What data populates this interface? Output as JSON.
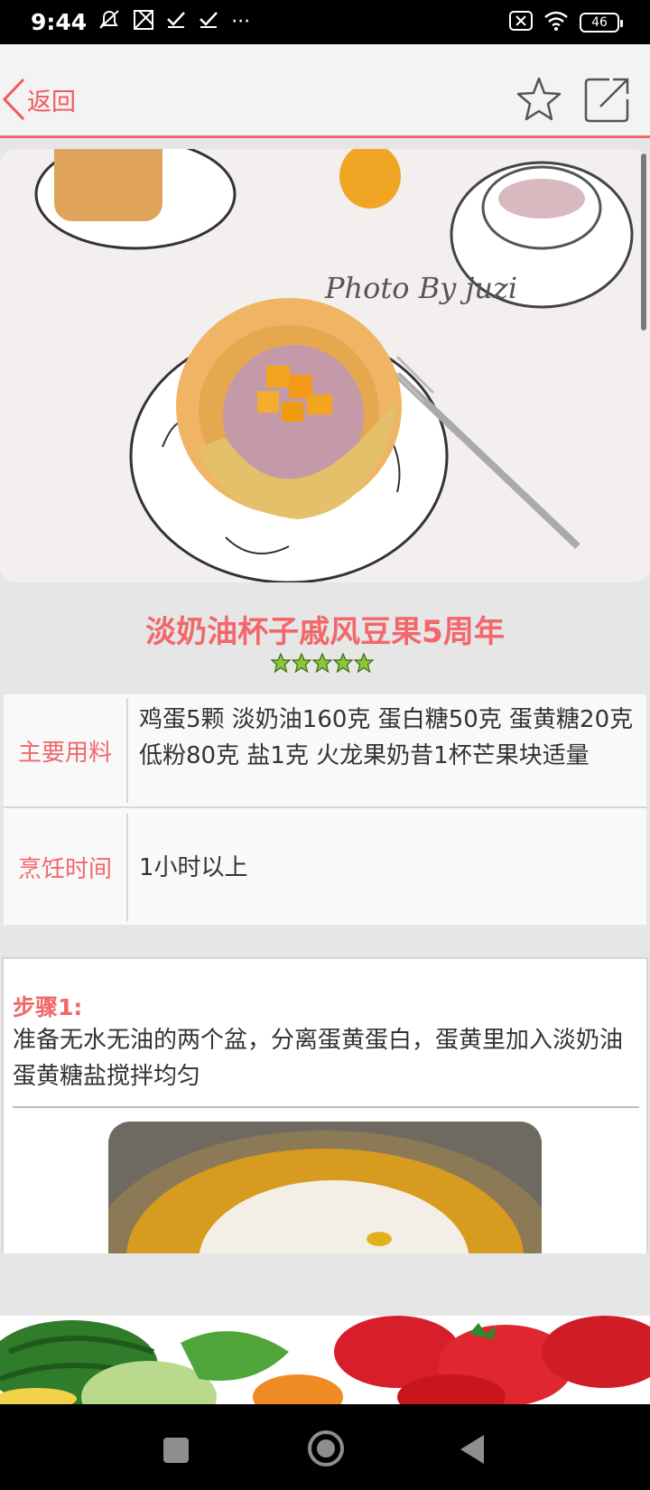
{
  "status_bar": {
    "time": "9:44",
    "left_icons": [
      "notification-off-icon",
      "screenshot-icon",
      "check-icon",
      "check-icon",
      "more-icon"
    ],
    "more": "···",
    "battery": "46"
  },
  "header": {
    "back_label": "返回",
    "accent_color": "#f2676a"
  },
  "recipe": {
    "title": "淡奶油杯子戚风豆果5周年",
    "rating": 5,
    "photo_watermark": "Photo By juzi"
  },
  "info": {
    "ingredients_label": "主要用料",
    "ingredients_value": "鸡蛋5颗 淡奶油160克 蛋白糖50克 蛋黄糖20克 低粉80克 盐1克 火龙果奶昔1杯芒果块适量",
    "time_label": "烹饪时间",
    "time_value": "1小时以上"
  },
  "steps": [
    {
      "label": "步骤1:",
      "text": "准备无水无油的两个盆，分离蛋黄蛋白，蛋黄里加入淡奶油蛋黄糖盐搅拌均匀"
    }
  ]
}
